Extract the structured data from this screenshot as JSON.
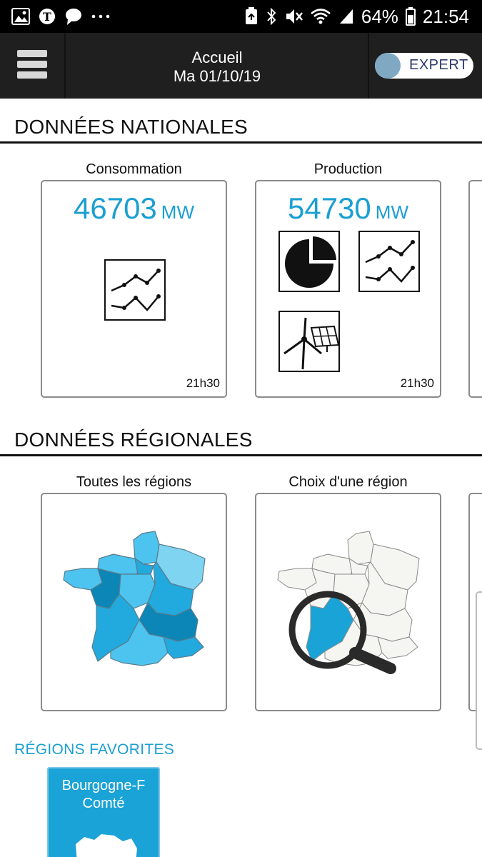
{
  "status_bar": {
    "battery": "64%",
    "time": "21:54",
    "left_icons": [
      "image-icon",
      "nyt-icon",
      "chat-icon",
      "more-dots-icon"
    ],
    "right_icons": [
      "recycle-icon",
      "bluetooth-icon",
      "mute-icon",
      "wifi-icon",
      "signal-icon",
      "battery-icon"
    ]
  },
  "header": {
    "title": "Accueil",
    "date": "Ma 01/10/19",
    "toggle_label": "EXPERT",
    "toggle_color": "#7fa8c3"
  },
  "national": {
    "section_title": "DONNÉES NATIONALES",
    "cards": [
      {
        "label": "Consommation",
        "value": "46703",
        "unit": "MW",
        "time": "21h30"
      },
      {
        "label": "Production",
        "value": "54730",
        "unit": "MW",
        "time": "21h30"
      }
    ]
  },
  "regional": {
    "section_title": "DONNÉES RÉGIONALES",
    "cards": [
      {
        "label": "Toutes les régions"
      },
      {
        "label": "Choix d'une région"
      }
    ]
  },
  "favorites": {
    "title": "RÉGIONS FAVORITES",
    "items": [
      {
        "line1": "Bourgogne-F",
        "line2": "Comté"
      }
    ]
  },
  "colors": {
    "accent": "#1a9fd3",
    "header_bg": "#1f1f1f",
    "map_dark": "#0b86b6",
    "map_mid": "#22a9de",
    "map_light": "#4cc4ef",
    "map_pale": "#7fd4f2"
  }
}
